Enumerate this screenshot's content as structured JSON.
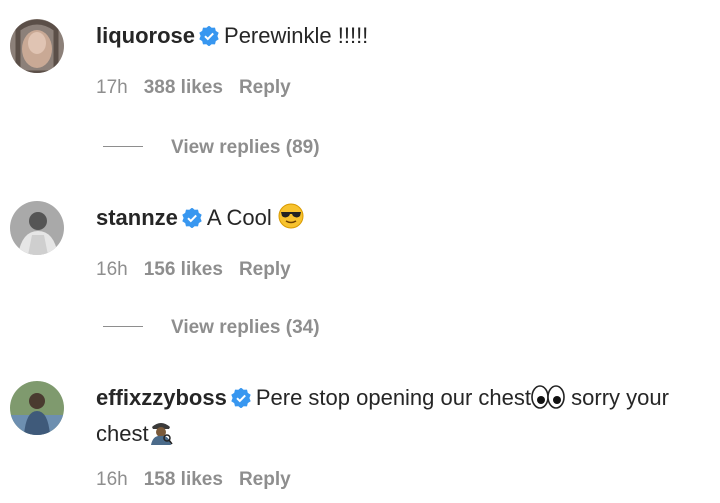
{
  "comments": [
    {
      "username": "liquorose",
      "text": "Perewinkle !!!!!",
      "time": "17h",
      "likes": "388 likes",
      "reply": "Reply",
      "view_replies": "View replies (89)",
      "avatar_icon": "avatar-liquorose"
    },
    {
      "username": "stannze",
      "text": "A Cool",
      "emoji": "sunglasses-emoji",
      "time": "16h",
      "likes": "156 likes",
      "reply": "Reply",
      "view_replies": "View replies (34)",
      "avatar_icon": "avatar-stannze"
    },
    {
      "username": "effixzzyboss",
      "text_a": "Pere stop opening our chest",
      "text_b": " sorry your chest",
      "emojis": [
        "eyes-emoji",
        "detective-emoji"
      ],
      "time": "16h",
      "likes": "158 likes",
      "reply": "Reply",
      "avatar_icon": "avatar-effixzzyboss"
    }
  ],
  "colors": {
    "verified": "#3897f0",
    "muted": "#8e8e8e",
    "text": "#262626"
  }
}
